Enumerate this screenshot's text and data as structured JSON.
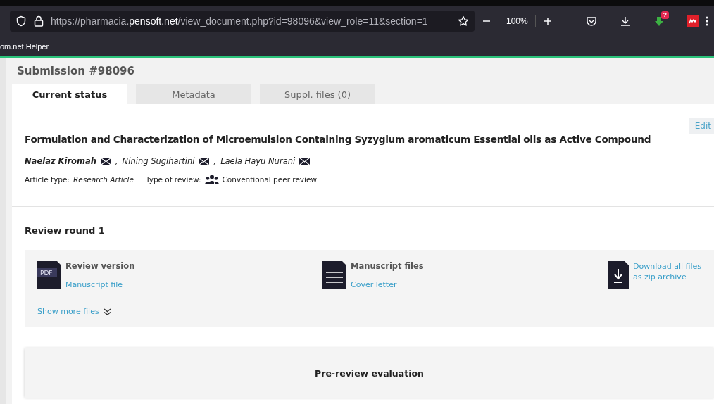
{
  "browser": {
    "url": "https://pharmacia.**pensoft.net**/view_document.php?id=98096&view_role=11&section=1",
    "zoom": "100%",
    "extension_badge": "?",
    "bookmark": "om.net Helper"
  },
  "submission": {
    "title": "Submission #98096",
    "tabs": [
      {
        "label": "Current status",
        "selected": true
      },
      {
        "label": "Metadata",
        "selected": false
      },
      {
        "label": "Suppl. files (0)",
        "selected": false
      }
    ],
    "edit_button": "Edit",
    "article_title": "Formulation and Characterization of Microemulsion Containing Syzygium aromaticum Essential oils as Active Compound",
    "authors": [
      {
        "name": "Naelaz Kiromah",
        "corresponding": true,
        "separator": ","
      },
      {
        "name": "Nining Sugihartini",
        "corresponding": false,
        "separator": ","
      },
      {
        "name": "Laela Hayu Nurani",
        "corresponding": false
      }
    ],
    "article_type_label": "Article type:",
    "article_type": "Research Article",
    "review_type_label": "Type of review:",
    "review_type": "Conventional peer review"
  },
  "review_round": {
    "title": "Review round 1",
    "files": [
      {
        "kind": "pdf",
        "icon_text": "PDF",
        "title": "Review version",
        "link": "Manuscript file"
      },
      {
        "kind": "doc",
        "title": "Manuscript files",
        "link": "Cover letter"
      },
      {
        "kind": "download",
        "link": "Download all files as zip archive"
      }
    ],
    "show_more": "Show more files"
  },
  "pre_review": {
    "title": "Pre-review evaluation"
  }
}
